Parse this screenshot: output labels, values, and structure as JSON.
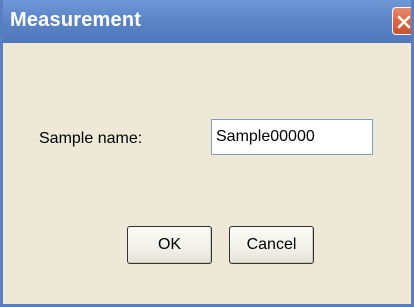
{
  "window": {
    "title": "Measurement"
  },
  "form": {
    "sample_name_label": "Sample name:",
    "sample_name_value": "Sample00000"
  },
  "buttons": {
    "ok_label": "OK",
    "cancel_label": "Cancel"
  },
  "icons": {
    "close": "close-icon"
  },
  "colors": {
    "titlebar": "#5c85c8",
    "dialog_background": "#ede9d6",
    "close_button": "#d9653f"
  }
}
